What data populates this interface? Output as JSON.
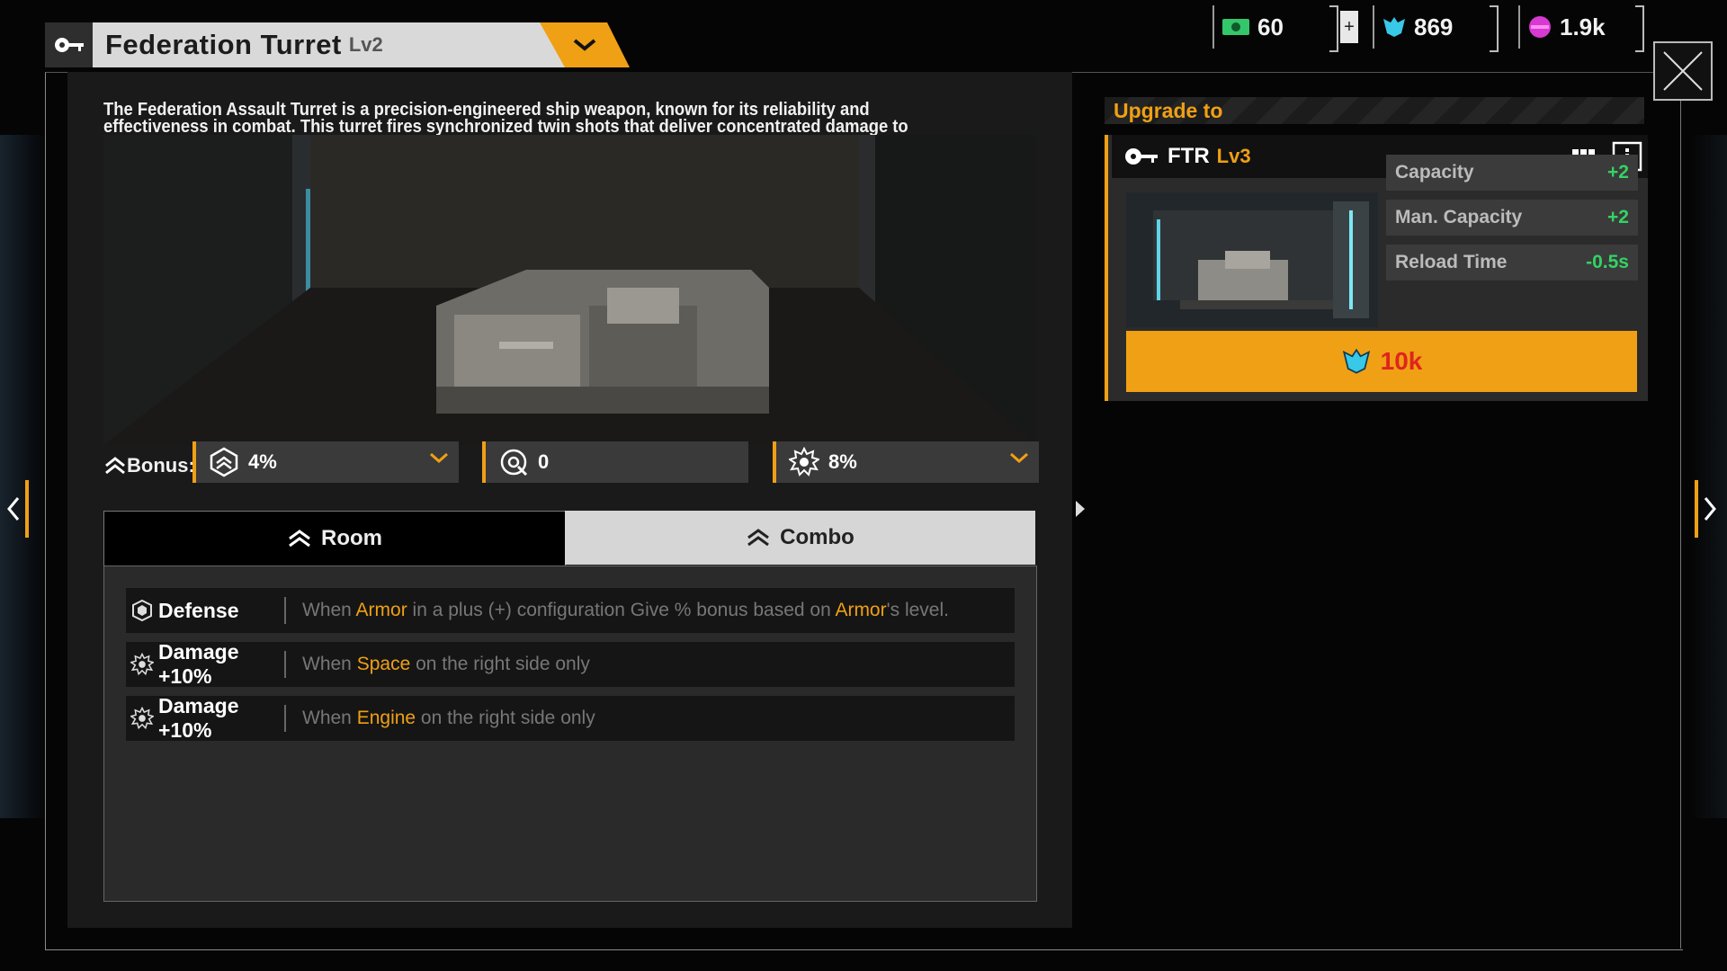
{
  "title": {
    "name": "Federation Turret",
    "level": "Lv2"
  },
  "currencies": [
    {
      "icon": "cash-icon",
      "value": "60"
    },
    {
      "icon": "crystal-icon",
      "value": "869"
    },
    {
      "icon": "orb-icon",
      "value": "1.9k"
    }
  ],
  "plus_label": "+",
  "description": "The Federation Assault Turret is a precision-engineered ship weapon, known for its reliability and effectiveness in combat. This turret fires synchronized twin shots that deliver concentrated damage to targets.",
  "bonus": {
    "label": "Bonus:",
    "items": [
      {
        "icon": "shield-rank-icon",
        "value": "4%"
      },
      {
        "icon": "crosshair-icon",
        "value": "0"
      },
      {
        "icon": "gear-burst-icon",
        "value": "8%"
      }
    ]
  },
  "tabs": {
    "room": "Room",
    "combo": "Combo"
  },
  "combo_rows": [
    {
      "icon": "hexagon-icon",
      "name": "Defense",
      "pre": "When ",
      "key1": "Armor",
      "mid": " in a plus (+) configuration Give % bonus based on ",
      "key2": "Armor",
      "post": "'s level."
    },
    {
      "icon": "gear-burst-icon",
      "name": "Damage +10%",
      "pre": "When ",
      "key1": "Space",
      "mid": " on the right side only",
      "key2": "",
      "post": ""
    },
    {
      "icon": "gear-burst-icon",
      "name": "Damage +10%",
      "pre": "When ",
      "key1": "Engine",
      "mid": " on the right side only",
      "key2": "",
      "post": ""
    }
  ],
  "upgrade": {
    "header": "Upgrade to",
    "name": "FTR",
    "level": "Lv3",
    "stats": [
      {
        "label": "Capacity",
        "delta": "+2"
      },
      {
        "label": "Man. Capacity",
        "delta": "+2"
      },
      {
        "label": "Reload Time",
        "delta": "-0.5s"
      }
    ],
    "cost": "10k"
  },
  "colors": {
    "accent": "#f0a014",
    "positive": "#34d264",
    "cost": "#e0241e"
  }
}
